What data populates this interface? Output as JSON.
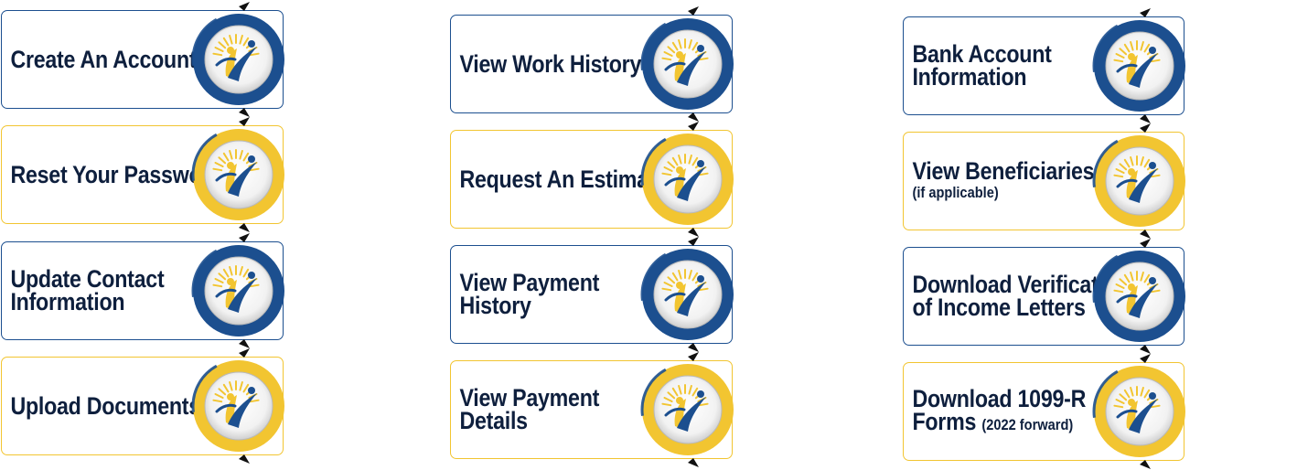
{
  "columns": [
    {
      "items": [
        {
          "lines": [
            "Create An Account"
          ],
          "theme": "blue"
        },
        {
          "lines": [
            "Reset Your Password"
          ],
          "theme": "gold"
        },
        {
          "lines": [
            "Update Contact",
            "Information"
          ],
          "theme": "blue"
        },
        {
          "lines": [
            "Upload Documents"
          ],
          "theme": "gold"
        }
      ]
    },
    {
      "items": [
        {
          "lines": [
            "View Work History"
          ],
          "theme": "blue"
        },
        {
          "lines": [
            "Request An Estimate"
          ],
          "theme": "gold"
        },
        {
          "lines": [
            "View Payment",
            "History"
          ],
          "theme": "blue"
        },
        {
          "lines": [
            "View Payment",
            "Details"
          ],
          "theme": "gold"
        }
      ]
    },
    {
      "items": [
        {
          "lines": [
            "Bank Account",
            "Information"
          ],
          "theme": "blue"
        },
        {
          "lines": [
            "View Beneficiaries"
          ],
          "sub": "(if applicable)",
          "theme": "gold"
        },
        {
          "lines": [
            "Download Verification",
            "of Income Letters"
          ],
          "theme": "blue"
        },
        {
          "lines": [
            "Download 1099-R",
            "Forms"
          ],
          "suffix": "(2022 forward)",
          "theme": "gold"
        }
      ]
    }
  ],
  "icon": "sun-figure-logo-icon",
  "colors": {
    "blue": "#1c4f8f",
    "gold": "#f2c531",
    "text": "#0e1f3d",
    "arrow": "#111111"
  }
}
